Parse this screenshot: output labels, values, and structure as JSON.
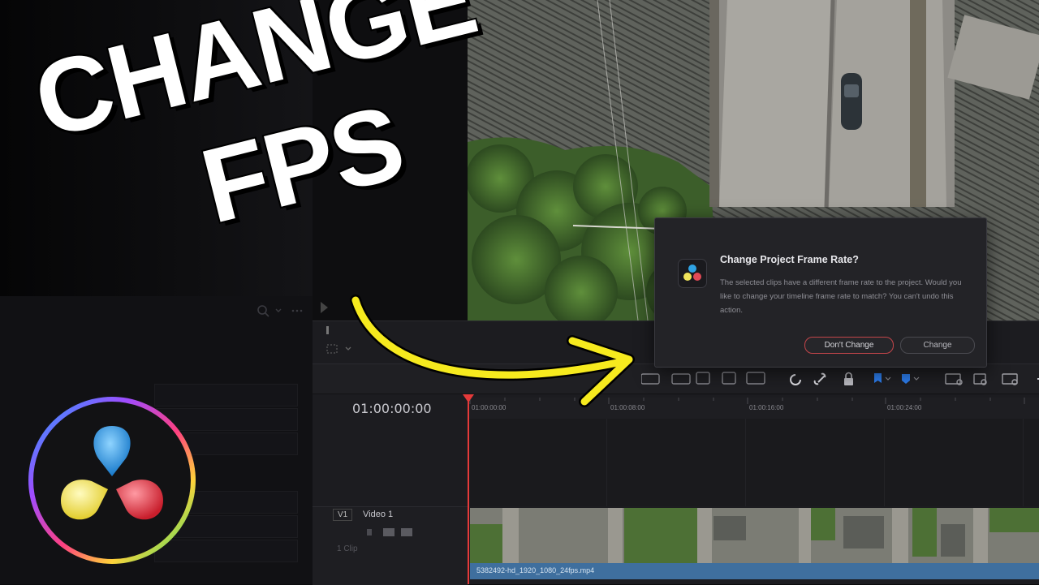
{
  "headline": {
    "line1": "CHANGE",
    "line2": "FPS"
  },
  "dialog": {
    "title": "Change Project Frame Rate?",
    "body": "The selected clips have a different frame rate to the project. Would you like to change your timeline frame rate to match? You can't undo this action.",
    "dont_change_label": "Don't Change",
    "change_label": "Change"
  },
  "timeline": {
    "timecode": "01:00:00:00",
    "ruler_ticks": [
      "01:00:00:00",
      "01:00:08:00",
      "01:00:16:00",
      "01:00:24:00"
    ],
    "track": {
      "id": "V1",
      "name": "Video 1",
      "clip_count": "1 Clip"
    },
    "clip_name": "5382492-hd_1920_1080_24fps.mp4"
  },
  "colors": {
    "arrow": "#f6ea1e",
    "dont_change_border": "#c4454a",
    "playhead": "#e53a3a",
    "clip_bar": "#3f6f9e"
  },
  "icons": [
    "search-icon",
    "more-icon",
    "davinci-resolve-logo",
    "curved-arrow",
    "magnet-icon",
    "link-icon",
    "lock-icon",
    "flag-icon",
    "marker-icon",
    "zoom-icon"
  ]
}
